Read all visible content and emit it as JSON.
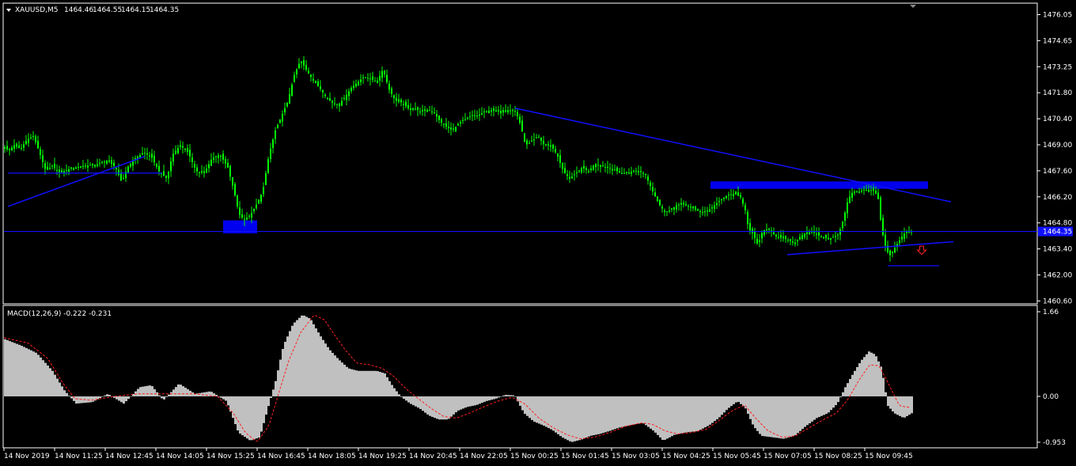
{
  "chart_data": [
    {
      "type": "candlestick",
      "header": {
        "symbol": "XAUUSD,M5",
        "ohlc": [
          "1464.46",
          "1464.55",
          "1464.15",
          "1464.35"
        ]
      },
      "y_ticks": [
        "1476.05",
        "1474.65",
        "1473.25",
        "1471.80",
        "1470.40",
        "1469.00",
        "1467.60",
        "1466.20",
        "1464.80",
        "1463.40",
        "1462.00",
        "1460.60"
      ],
      "ylim": [
        1460.6,
        1476.5
      ],
      "current_price_label": "1464.35",
      "x_ticks": [
        "14 Nov 2019",
        "14 Nov 11:25",
        "14 Nov 12:45",
        "14 Nov 14:05",
        "14 Nov 15:25",
        "14 Nov 16:45",
        "14 Nov 18:05",
        "14 Nov 19:25",
        "14 Nov 20:45",
        "14 Nov 22:05",
        "15 Nov 00:25",
        "15 Nov 01:45",
        "15 Nov 03:05",
        "15 Nov 04:25",
        "15 Nov 05:45",
        "15 Nov 07:05",
        "15 Nov 08:25",
        "15 Nov 09:45"
      ],
      "close_path": [
        [
          0,
          1468.9
        ],
        [
          5,
          1468.7
        ],
        [
          12,
          1469.0
        ],
        [
          20,
          1468.8
        ],
        [
          28,
          1469.3
        ],
        [
          36,
          1469.5
        ],
        [
          44,
          1468.6
        ],
        [
          52,
          1467.6
        ],
        [
          60,
          1467.9
        ],
        [
          70,
          1467.5
        ],
        [
          80,
          1467.7
        ],
        [
          90,
          1467.8
        ],
        [
          100,
          1467.9
        ],
        [
          110,
          1467.9
        ],
        [
          120,
          1468.0
        ],
        [
          130,
          1468.2
        ],
        [
          140,
          1467.8
        ],
        [
          148,
          1467.0
        ],
        [
          155,
          1467.8
        ],
        [
          165,
          1468.3
        ],
        [
          175,
          1468.6
        ],
        [
          185,
          1468.4
        ],
        [
          195,
          1467.6
        ],
        [
          205,
          1467.2
        ],
        [
          212,
          1468.5
        ],
        [
          222,
          1469.0
        ],
        [
          232,
          1468.6
        ],
        [
          242,
          1467.6
        ],
        [
          252,
          1467.5
        ],
        [
          262,
          1468.3
        ],
        [
          272,
          1468.5
        ],
        [
          282,
          1467.8
        ],
        [
          290,
          1466.5
        ],
        [
          296,
          1465.3
        ],
        [
          302,
          1465.0
        ],
        [
          310,
          1465.2
        ],
        [
          318,
          1465.8
        ],
        [
          326,
          1466.5
        ],
        [
          334,
          1468.5
        ],
        [
          342,
          1469.8
        ],
        [
          350,
          1470.6
        ],
        [
          358,
          1471.4
        ],
        [
          366,
          1472.8
        ],
        [
          374,
          1473.6
        ],
        [
          382,
          1473.0
        ],
        [
          390,
          1472.5
        ],
        [
          398,
          1472.1
        ],
        [
          406,
          1471.6
        ],
        [
          414,
          1471.3
        ],
        [
          422,
          1471.2
        ],
        [
          430,
          1471.6
        ],
        [
          438,
          1472.1
        ],
        [
          446,
          1472.4
        ],
        [
          454,
          1472.7
        ],
        [
          462,
          1472.6
        ],
        [
          470,
          1472.4
        ],
        [
          478,
          1473.1
        ],
        [
          486,
          1472.0
        ],
        [
          494,
          1471.4
        ],
        [
          502,
          1471.3
        ],
        [
          510,
          1471.0
        ],
        [
          518,
          1471.0
        ],
        [
          526,
          1470.8
        ],
        [
          534,
          1470.9
        ],
        [
          542,
          1470.8
        ],
        [
          550,
          1470.3
        ],
        [
          558,
          1470.0
        ],
        [
          566,
          1469.8
        ],
        [
          574,
          1470.2
        ],
        [
          582,
          1470.4
        ],
        [
          590,
          1470.6
        ],
        [
          598,
          1470.6
        ],
        [
          606,
          1470.8
        ],
        [
          614,
          1470.9
        ],
        [
          622,
          1470.8
        ],
        [
          630,
          1470.9
        ],
        [
          638,
          1470.9
        ],
        [
          646,
          1470.8
        ],
        [
          652,
          1470.1
        ],
        [
          658,
          1469.0
        ],
        [
          666,
          1469.2
        ],
        [
          674,
          1469.5
        ],
        [
          682,
          1469.0
        ],
        [
          690,
          1469.0
        ],
        [
          698,
          1468.5
        ],
        [
          706,
          1467.6
        ],
        [
          714,
          1467.2
        ],
        [
          722,
          1467.5
        ],
        [
          730,
          1467.8
        ],
        [
          738,
          1467.6
        ],
        [
          746,
          1468.0
        ],
        [
          754,
          1467.9
        ],
        [
          762,
          1467.8
        ],
        [
          770,
          1467.7
        ],
        [
          778,
          1467.5
        ],
        [
          786,
          1467.5
        ],
        [
          794,
          1467.6
        ],
        [
          802,
          1467.6
        ],
        [
          810,
          1467.4
        ],
        [
          818,
          1466.6
        ],
        [
          826,
          1465.9
        ],
        [
          834,
          1465.4
        ],
        [
          842,
          1465.5
        ],
        [
          850,
          1465.8
        ],
        [
          858,
          1465.8
        ],
        [
          866,
          1465.7
        ],
        [
          874,
          1465.5
        ],
        [
          882,
          1465.4
        ],
        [
          890,
          1465.5
        ],
        [
          898,
          1465.8
        ],
        [
          906,
          1466.1
        ],
        [
          914,
          1466.3
        ],
        [
          922,
          1466.4
        ],
        [
          930,
          1466.2
        ],
        [
          936,
          1465.5
        ],
        [
          940,
          1464.5
        ],
        [
          946,
          1464.2
        ],
        [
          952,
          1463.6
        ],
        [
          958,
          1464.4
        ],
        [
          966,
          1464.5
        ],
        [
          974,
          1464.1
        ],
        [
          982,
          1464.0
        ],
        [
          990,
          1463.9
        ],
        [
          998,
          1463.7
        ],
        [
          1006,
          1464.1
        ],
        [
          1014,
          1464.3
        ],
        [
          1022,
          1464.3
        ],
        [
          1030,
          1464.1
        ],
        [
          1038,
          1464.0
        ],
        [
          1046,
          1464.0
        ],
        [
          1054,
          1464.2
        ],
        [
          1060,
          1465.0
        ],
        [
          1066,
          1466.1
        ],
        [
          1072,
          1466.5
        ],
        [
          1080,
          1466.5
        ],
        [
          1088,
          1466.6
        ],
        [
          1094,
          1466.6
        ],
        [
          1100,
          1466.5
        ],
        [
          1104,
          1466.1
        ],
        [
          1108,
          1464.6
        ],
        [
          1112,
          1463.7
        ],
        [
          1118,
          1463.0
        ],
        [
          1124,
          1463.4
        ],
        [
          1130,
          1463.8
        ],
        [
          1136,
          1464.2
        ],
        [
          1142,
          1464.4
        ],
        [
          1146,
          1464.35
        ]
      ],
      "horizontal_lines": [
        {
          "name": "support-line",
          "y": 1464.35,
          "x": [
            0,
            1310
          ],
          "color": "#1010ff"
        },
        {
          "name": "left-level-line",
          "y": 1467.5,
          "x": [
            5,
            200
          ],
          "color": "#1010ff"
        },
        {
          "name": "low-level-line",
          "y": 1462.5,
          "x": [
            1117,
            1182
          ],
          "color": "#1010ff"
        }
      ],
      "trend_lines": [
        {
          "name": "upper-trendline",
          "from": [
            646,
            1471.0
          ],
          "to": [
            1197,
            1465.95
          ],
          "color": "#1010ff"
        },
        {
          "name": "lower-trendline",
          "from": [
            990,
            1463.1
          ],
          "to": [
            1200,
            1463.8
          ],
          "color": "#1010ff"
        },
        {
          "name": "left-trendline",
          "from": [
            5,
            1465.7
          ],
          "to": [
            178,
            1468.4
          ],
          "color": "#1010ff"
        }
      ],
      "zones": [
        {
          "name": "resistance-zone",
          "x": [
            893,
            1168
          ],
          "y": [
            1466.65,
            1467.05
          ],
          "color": "#0000ee"
        },
        {
          "name": "support-zone",
          "x": [
            277,
            320
          ],
          "y": [
            1464.25,
            1464.95
          ],
          "color": "#0000ee"
        }
      ],
      "down_arrow": {
        "x": 1160,
        "y": 1463.3,
        "color": "#ff2020"
      },
      "candle_color": "#00ff00",
      "background": "#000000",
      "level_color": "#1010ff"
    },
    {
      "type": "bar",
      "title": "MACD(12,26,9) -0.222 -0.231",
      "y_ticks": [
        "1.66",
        "0.00",
        "-0.953"
      ],
      "ylim": [
        -0.953,
        1.66
      ],
      "histogram_color": "#c0c0c0",
      "signal_color": "#ff2020",
      "histogram_keys": [
        [
          0,
          1.12
        ],
        [
          20,
          1.0
        ],
        [
          40,
          0.85
        ],
        [
          60,
          0.5
        ],
        [
          75,
          0.12
        ],
        [
          90,
          -0.15
        ],
        [
          110,
          -0.12
        ],
        [
          130,
          0.05
        ],
        [
          150,
          -0.15
        ],
        [
          170,
          0.18
        ],
        [
          185,
          0.22
        ],
        [
          200,
          -0.08
        ],
        [
          220,
          0.25
        ],
        [
          240,
          0.05
        ],
        [
          260,
          0.1
        ],
        [
          280,
          -0.1
        ],
        [
          295,
          -0.75
        ],
        [
          310,
          -0.92
        ],
        [
          322,
          -0.85
        ],
        [
          333,
          -0.2
        ],
        [
          342,
          0.3
        ],
        [
          352,
          1.0
        ],
        [
          364,
          1.42
        ],
        [
          376,
          1.6
        ],
        [
          386,
          1.52
        ],
        [
          398,
          1.2
        ],
        [
          410,
          0.92
        ],
        [
          422,
          0.72
        ],
        [
          434,
          0.55
        ],
        [
          446,
          0.5
        ],
        [
          458,
          0.5
        ],
        [
          470,
          0.5
        ],
        [
          480,
          0.45
        ],
        [
          490,
          0.2
        ],
        [
          500,
          0.0
        ],
        [
          512,
          -0.15
        ],
        [
          524,
          -0.25
        ],
        [
          536,
          -0.4
        ],
        [
          548,
          -0.48
        ],
        [
          560,
          -0.48
        ],
        [
          572,
          -0.3
        ],
        [
          584,
          -0.22
        ],
        [
          596,
          -0.18
        ],
        [
          608,
          -0.1
        ],
        [
          620,
          -0.05
        ],
        [
          632,
          0.03
        ],
        [
          644,
          0.02
        ],
        [
          656,
          -0.35
        ],
        [
          668,
          -0.52
        ],
        [
          680,
          -0.6
        ],
        [
          692,
          -0.7
        ],
        [
          704,
          -0.85
        ],
        [
          716,
          -0.95
        ],
        [
          728,
          -0.9
        ],
        [
          740,
          -0.82
        ],
        [
          752,
          -0.78
        ],
        [
          764,
          -0.72
        ],
        [
          776,
          -0.65
        ],
        [
          790,
          -0.6
        ],
        [
          806,
          -0.55
        ],
        [
          820,
          -0.72
        ],
        [
          832,
          -0.92
        ],
        [
          846,
          -0.8
        ],
        [
          860,
          -0.75
        ],
        [
          876,
          -0.72
        ],
        [
          890,
          -0.6
        ],
        [
          902,
          -0.45
        ],
        [
          914,
          -0.25
        ],
        [
          926,
          -0.1
        ],
        [
          936,
          -0.25
        ],
        [
          946,
          -0.62
        ],
        [
          956,
          -0.82
        ],
        [
          970,
          -0.85
        ],
        [
          984,
          -0.88
        ],
        [
          998,
          -0.82
        ],
        [
          1012,
          -0.62
        ],
        [
          1026,
          -0.45
        ],
        [
          1040,
          -0.35
        ],
        [
          1052,
          -0.15
        ],
        [
          1062,
          0.18
        ],
        [
          1072,
          0.45
        ],
        [
          1082,
          0.7
        ],
        [
          1092,
          0.88
        ],
        [
          1100,
          0.82
        ],
        [
          1108,
          0.55
        ],
        [
          1116,
          -0.2
        ],
        [
          1124,
          -0.35
        ],
        [
          1136,
          -0.45
        ],
        [
          1146,
          -0.35
        ]
      ],
      "signal_keys": [
        [
          0,
          1.15
        ],
        [
          30,
          1.05
        ],
        [
          55,
          0.75
        ],
        [
          75,
          0.25
        ],
        [
          90,
          -0.05
        ],
        [
          110,
          -0.08
        ],
        [
          140,
          0.0
        ],
        [
          170,
          0.05
        ],
        [
          200,
          0.05
        ],
        [
          240,
          0.05
        ],
        [
          270,
          0.0
        ],
        [
          290,
          -0.35
        ],
        [
          305,
          -0.75
        ],
        [
          320,
          -0.95
        ],
        [
          335,
          -0.6
        ],
        [
          348,
          0.1
        ],
        [
          360,
          0.7
        ],
        [
          375,
          1.25
        ],
        [
          392,
          1.6
        ],
        [
          405,
          1.5
        ],
        [
          418,
          1.2
        ],
        [
          432,
          0.9
        ],
        [
          446,
          0.65
        ],
        [
          462,
          0.62
        ],
        [
          478,
          0.55
        ],
        [
          492,
          0.4
        ],
        [
          508,
          0.15
        ],
        [
          524,
          -0.05
        ],
        [
          540,
          -0.25
        ],
        [
          556,
          -0.42
        ],
        [
          572,
          -0.45
        ],
        [
          588,
          -0.35
        ],
        [
          606,
          -0.22
        ],
        [
          624,
          -0.1
        ],
        [
          642,
          -0.02
        ],
        [
          658,
          -0.15
        ],
        [
          676,
          -0.45
        ],
        [
          694,
          -0.65
        ],
        [
          712,
          -0.8
        ],
        [
          728,
          -0.88
        ],
        [
          746,
          -0.85
        ],
        [
          766,
          -0.75
        ],
        [
          786,
          -0.62
        ],
        [
          806,
          -0.55
        ],
        [
          820,
          -0.58
        ],
        [
          836,
          -0.72
        ],
        [
          852,
          -0.78
        ],
        [
          870,
          -0.75
        ],
        [
          888,
          -0.68
        ],
        [
          904,
          -0.5
        ],
        [
          920,
          -0.3
        ],
        [
          936,
          -0.18
        ],
        [
          950,
          -0.45
        ],
        [
          966,
          -0.72
        ],
        [
          984,
          -0.85
        ],
        [
          1000,
          -0.82
        ],
        [
          1018,
          -0.65
        ],
        [
          1036,
          -0.48
        ],
        [
          1052,
          -0.35
        ],
        [
          1066,
          -0.08
        ],
        [
          1080,
          0.3
        ],
        [
          1094,
          0.62
        ],
        [
          1106,
          0.6
        ],
        [
          1118,
          0.25
        ],
        [
          1132,
          -0.2
        ],
        [
          1146,
          -0.23
        ]
      ]
    }
  ]
}
